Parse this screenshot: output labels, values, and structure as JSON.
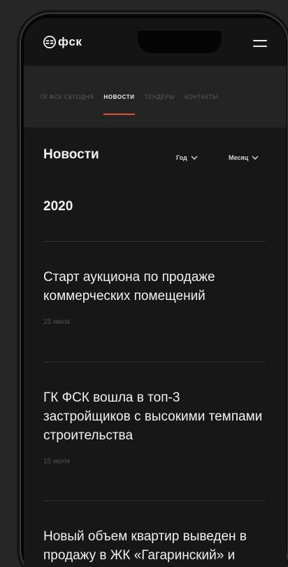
{
  "brand": {
    "logo_text": "фск"
  },
  "tabs": [
    {
      "label": "ГК ФСК сегодня",
      "active": false
    },
    {
      "label": "Новости",
      "active": true
    },
    {
      "label": "Тендеры",
      "active": false
    },
    {
      "label": "Контакты",
      "active": false
    }
  ],
  "page": {
    "title": "Новости",
    "filters": {
      "year": "Год",
      "month": "Месяц"
    },
    "year": "2020"
  },
  "news": [
    {
      "title": "Старт аукциона по продаже коммерческих помещений",
      "date": "15 июля"
    },
    {
      "title": "ГК ФСК вошла в топ-3 застройщиков с высокими темпами строительства",
      "date": "15 июля"
    },
    {
      "title": "Новый объем квартир выведен в продажу в ЖК «Гагаринский» и «Новый",
      "date": ""
    }
  ],
  "colors": {
    "accent": "#e0522c",
    "background": "#171717",
    "tab_bar": "#242424"
  }
}
